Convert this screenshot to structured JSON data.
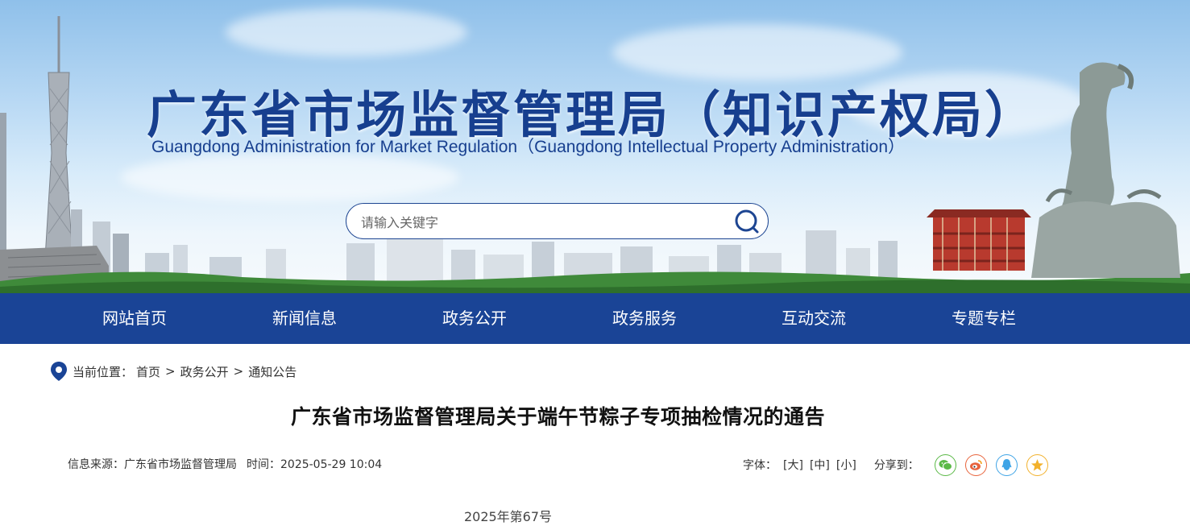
{
  "header": {
    "title": "广东省市场监督管理局（知识产权局）",
    "subtitle": "Guangdong Administration for Market Regulation（Guangdong Intellectual Property Administration）",
    "search_placeholder": "请输入关键字"
  },
  "nav": {
    "items": [
      {
        "label": "网站首页"
      },
      {
        "label": "新闻信息"
      },
      {
        "label": "政务公开"
      },
      {
        "label": "政务服务"
      },
      {
        "label": "互动交流"
      },
      {
        "label": "专题专栏"
      }
    ]
  },
  "breadcrumb": {
    "label": "当前位置：",
    "items": [
      "首页",
      "政务公开",
      "通知公告"
    ],
    "separator": ">"
  },
  "article": {
    "title": "广东省市场监督管理局关于端午节粽子专项抽检情况的通告",
    "source": "信息来源：广东省市场监督管理局",
    "time": "时间：2025-05-29 10:04",
    "font_label": "字体：",
    "font_sizes": [
      "[大]",
      "[中]",
      "[小]"
    ],
    "share_label": "分享到：",
    "share_icons": [
      "wechat-icon",
      "weibo-icon",
      "qq-icon",
      "qzone-icon"
    ],
    "doc_number": "2025年第67号"
  },
  "colors": {
    "brand_blue": "#1a4496",
    "title_blue": "#173f8f",
    "wechat": "#5bb947",
    "weibo": "#e8643c",
    "qq": "#3fa4e6",
    "qzone": "#f2b12c"
  }
}
